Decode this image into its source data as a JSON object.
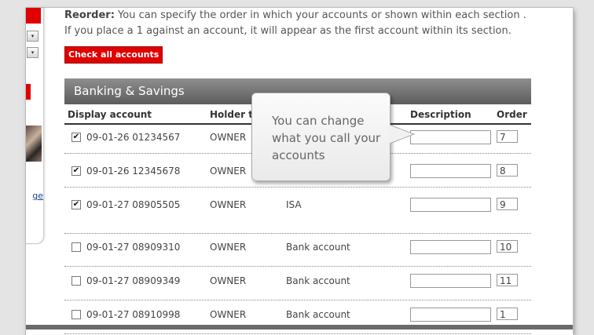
{
  "reorder": {
    "label": "Reorder:",
    "text": "You can specify the order in which your accounts or shown within each section . If you place a 1 against an account, it will appear as the first account within its section."
  },
  "check_all_label": "Check all accounts",
  "section": {
    "title": "Banking & Savings"
  },
  "columns": {
    "display": "Display account",
    "holder": "Holder t",
    "description": "Description",
    "order": "Order"
  },
  "callout": {
    "text": "You can change what you call your accounts"
  },
  "sidebar": {
    "link_fragment": "ge"
  },
  "rows": [
    {
      "checked": true,
      "check_glyph": "✔",
      "account": "09-01-26 01234567",
      "holder": "OWNER",
      "type": "",
      "order": "7"
    },
    {
      "checked": true,
      "check_glyph": "✔",
      "account": "09-01-26 12345678",
      "holder": "OWNER",
      "type": "",
      "order": "8"
    },
    {
      "checked": true,
      "check_glyph": "✔",
      "account": "09-01-27 08905505",
      "holder": "OWNER",
      "type": "ISA",
      "order": "9"
    },
    {
      "checked": false,
      "check_glyph": "",
      "account": "09-01-27 08909310",
      "holder": "OWNER",
      "type": "Bank account",
      "order": "10"
    },
    {
      "checked": false,
      "check_glyph": "",
      "account": "09-01-27 08909349",
      "holder": "OWNER",
      "type": "Bank account",
      "order": "11"
    },
    {
      "checked": false,
      "check_glyph": "",
      "account": "09-01-27 08910998",
      "holder": "OWNER",
      "type": "Bank account",
      "order": "1"
    }
  ]
}
